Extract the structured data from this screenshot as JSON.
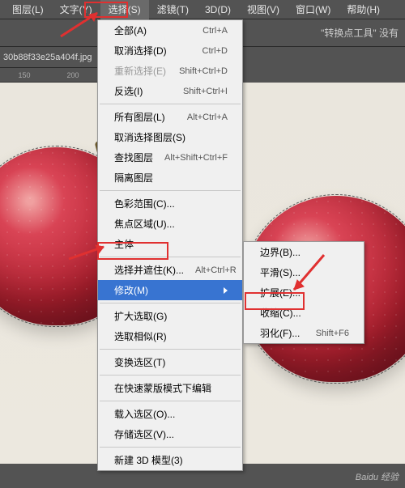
{
  "menubar": {
    "items": [
      {
        "label": "图层(L)"
      },
      {
        "label": "文字(Y)"
      },
      {
        "label": "选择(S)"
      },
      {
        "label": "滤镜(T)"
      },
      {
        "label": "3D(D)"
      },
      {
        "label": "视图(V)"
      },
      {
        "label": "窗口(W)"
      },
      {
        "label": "帮助(H)"
      }
    ],
    "active_index": 2
  },
  "toolbar": {
    "status_text": "\"转换点工具\" 没有"
  },
  "tab": {
    "filename": "30b88f33e25a404f.jpg"
  },
  "ruler": {
    "ticks": [
      "150",
      "200"
    ]
  },
  "menu_main": [
    {
      "label": "全部(A)",
      "shortcut": "Ctrl+A"
    },
    {
      "label": "取消选择(D)",
      "shortcut": "Ctrl+D"
    },
    {
      "label": "重新选择(E)",
      "shortcut": "Shift+Ctrl+D",
      "disabled": true
    },
    {
      "label": "反选(I)",
      "shortcut": "Shift+Ctrl+I"
    },
    {
      "sep": true
    },
    {
      "label": "所有图层(L)",
      "shortcut": "Alt+Ctrl+A"
    },
    {
      "label": "取消选择图层(S)",
      "shortcut": ""
    },
    {
      "label": "查找图层",
      "shortcut": "Alt+Shift+Ctrl+F"
    },
    {
      "label": "隔离图层",
      "shortcut": ""
    },
    {
      "sep": true
    },
    {
      "label": "色彩范围(C)...",
      "shortcut": ""
    },
    {
      "label": "焦点区域(U)...",
      "shortcut": ""
    },
    {
      "label": "主体",
      "shortcut": ""
    },
    {
      "sep": true
    },
    {
      "label": "选择并遮住(K)...",
      "shortcut": "Alt+Ctrl+R"
    },
    {
      "label": "修改(M)",
      "shortcut": "",
      "submenu": true,
      "highlight": true
    },
    {
      "sep": true
    },
    {
      "label": "扩大选取(G)",
      "shortcut": ""
    },
    {
      "label": "选取相似(R)",
      "shortcut": ""
    },
    {
      "sep": true
    },
    {
      "label": "变换选区(T)",
      "shortcut": ""
    },
    {
      "sep": true
    },
    {
      "label": "在快速蒙版模式下编辑",
      "shortcut": ""
    },
    {
      "sep": true
    },
    {
      "label": "载入选区(O)...",
      "shortcut": ""
    },
    {
      "label": "存储选区(V)...",
      "shortcut": ""
    },
    {
      "sep": true
    },
    {
      "label": "新建 3D 模型(3)",
      "shortcut": ""
    }
  ],
  "menu_sub": [
    {
      "label": "边界(B)...",
      "shortcut": ""
    },
    {
      "label": "平滑(S)...",
      "shortcut": ""
    },
    {
      "label": "扩展(E)...",
      "shortcut": ""
    },
    {
      "label": "收缩(C)...",
      "shortcut": ""
    },
    {
      "label": "羽化(F)...",
      "shortcut": "Shift+F6"
    }
  ],
  "watermark": "Baidu 经验"
}
